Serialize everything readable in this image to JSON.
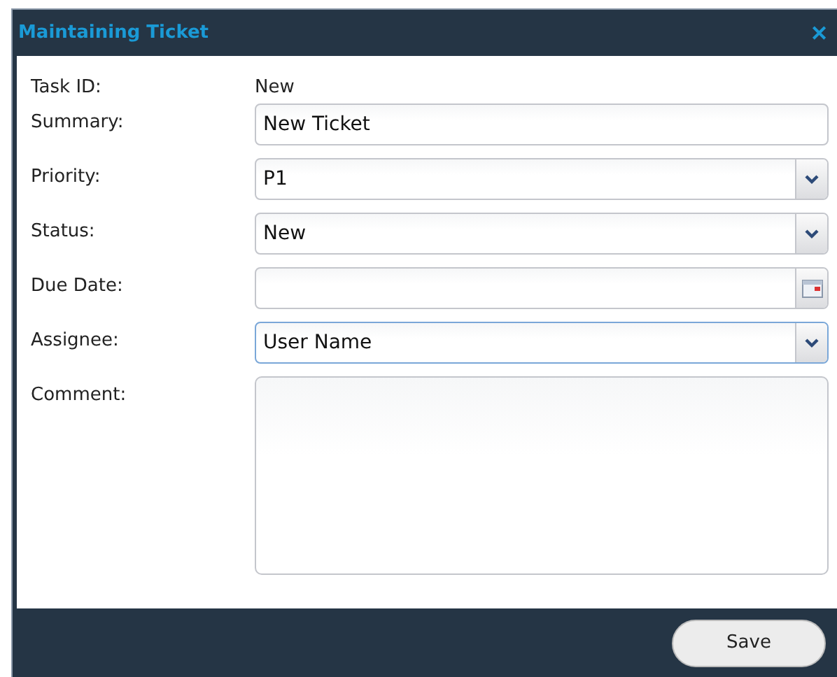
{
  "window": {
    "title": "Maintaining Ticket",
    "close": "✕"
  },
  "fields": [
    {
      "kind": "static",
      "label": "Task ID:",
      "value": "New"
    },
    {
      "kind": "text",
      "label": "Summary:",
      "value": "New Ticket",
      "focused": false
    },
    {
      "kind": "select",
      "label": "Priority:",
      "value": "P1",
      "focused": false
    },
    {
      "kind": "select",
      "label": "Status:",
      "value": "New",
      "focused": false
    },
    {
      "kind": "date",
      "label": "Due Date:",
      "focused": false
    },
    {
      "kind": "select",
      "label": "Assignee:",
      "value": "User Name",
      "focused": true
    },
    {
      "kind": "textarea",
      "label": "Comment:",
      "focused": false
    }
  ],
  "buttons": [
    "Save"
  ]
}
